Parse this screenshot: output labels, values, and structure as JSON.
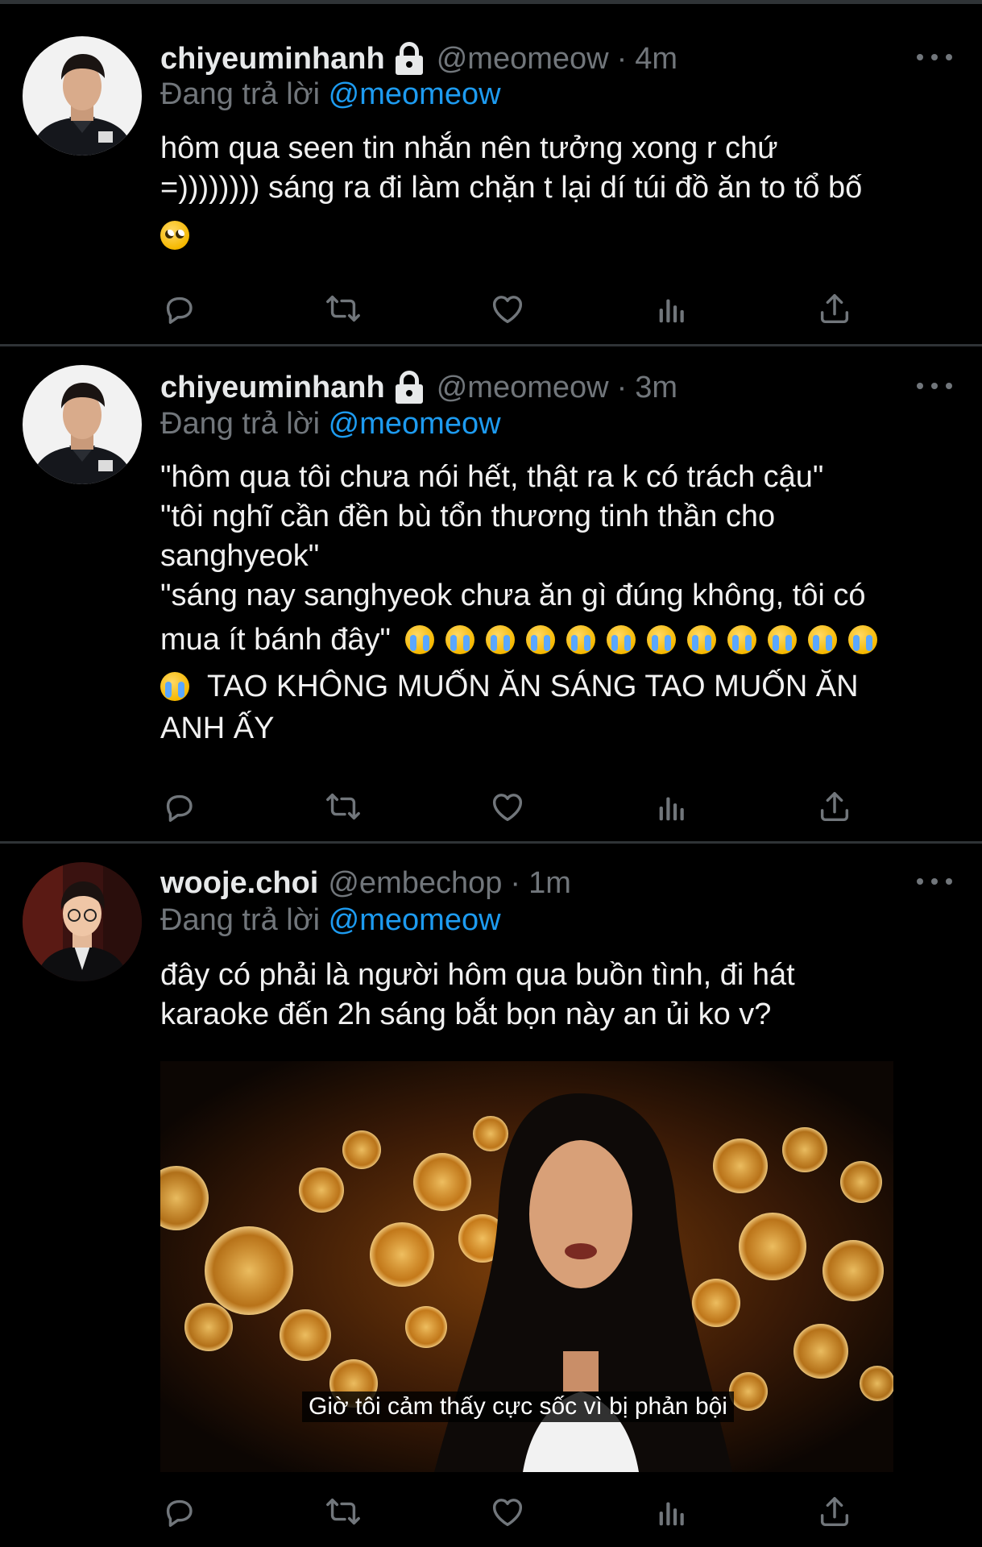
{
  "tweets": [
    {
      "display_name": "chiyeuminhanh",
      "protected": true,
      "handle": "@meomeow",
      "separator": "·",
      "time": "4m",
      "replying_prefix": "Đang trả lời",
      "replying_to": "@meomeow",
      "text_lines": [
        "hôm qua seen tin nhắn nên tưởng xong r chứ",
        "=)))))))) sáng ra đi làm chặn t lại dí túi đồ ăn to tổ bố"
      ],
      "emoji": "face-with-rolling-eyes"
    },
    {
      "display_name": "chiyeuminhanh",
      "protected": true,
      "handle": "@meomeow",
      "separator": "·",
      "time": "3m",
      "replying_prefix": "Đang trả lời",
      "replying_to": "@meomeow",
      "text_lines": [
        "\"hôm qua tôi chưa nói hết, thật ra k có trách cậu\"",
        "\"tôi nghĩ cần đền bù tổn thương tinh thần cho",
        "sanghyeok\"",
        "\"sáng nay sanghyeok chưa ăn gì đúng không, tôi có",
        "mua ít bánh đây\"",
        "TAO KHÔNG MUỐN ĂN SÁNG TAO MUỐN ĂN",
        "ANH ẤY"
      ],
      "emoji": "loudly-crying-face",
      "emoji_count": 13
    },
    {
      "display_name": "wooje.choi",
      "protected": false,
      "handle": "@embechop",
      "separator": "·",
      "time": "1m",
      "replying_prefix": "Đang trả lời",
      "replying_to": "@meomeow",
      "text_lines": [
        "đây có phải là người hôm qua buồn tình, đi hát",
        "karaoke đến 2h sáng bắt bọn này an ủi ko v?"
      ],
      "media_caption": "Giờ tôi cảm thấy cực sốc vì bị phản bội"
    }
  ],
  "action_icons": [
    "reply-icon",
    "retweet-icon",
    "like-icon",
    "views-icon",
    "share-icon"
  ],
  "colors": {
    "background": "#000000",
    "text": "#e7e9ea",
    "secondary": "#71767b",
    "link": "#1d9bf0",
    "divider": "#2f3336"
  }
}
